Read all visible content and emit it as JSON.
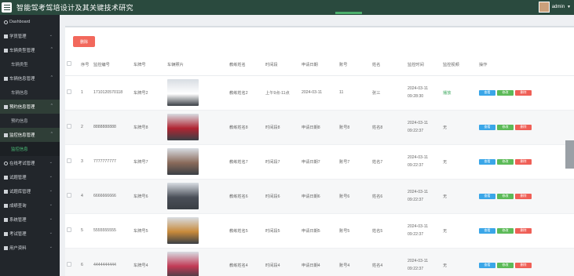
{
  "header": {
    "title": "智能驾考驾培设计及其关键技术研究",
    "user": "admin",
    "colors": {
      "bar": "#2a4a3e",
      "accent": "#4caf6c"
    }
  },
  "sidebar": {
    "items": [
      {
        "label": "Dashboard",
        "icon": "home-icon",
        "arrow": ""
      },
      {
        "label": "学员管理",
        "icon": "grid-icon",
        "arrow": "⌄"
      },
      {
        "label": "车辆类型管理",
        "icon": "grid-icon",
        "arrow": "^"
      },
      {
        "label": "车辆类型",
        "sub": true
      },
      {
        "label": "车辆信息管理",
        "icon": "grid-icon",
        "arrow": "^"
      },
      {
        "label": "车辆信息",
        "sub": true
      },
      {
        "label": "预约信息管理",
        "icon": "grid-icon",
        "arrow": "^",
        "active": true
      },
      {
        "label": "预约信息",
        "sub": true
      },
      {
        "label": "监控信息管理",
        "icon": "grid-icon",
        "arrow": "^",
        "active": true
      },
      {
        "label": "监控信息",
        "sub": true,
        "active": true
      },
      {
        "label": "在线考试管理",
        "icon": "gear-icon",
        "arrow": "⌄"
      },
      {
        "label": "试题管理",
        "icon": "grid-icon",
        "arrow": "⌄"
      },
      {
        "label": "试题库管理",
        "icon": "grid-icon",
        "arrow": "⌄"
      },
      {
        "label": "成绩查询",
        "icon": "grid-icon",
        "arrow": "⌄"
      },
      {
        "label": "系统管理",
        "icon": "grid-icon",
        "arrow": "⌄"
      },
      {
        "label": "考试管理",
        "icon": "grid-icon",
        "arrow": "⌄"
      },
      {
        "label": "用户资料",
        "icon": "doc-icon",
        "arrow": "⌄"
      }
    ]
  },
  "toolbar": {
    "delete_label": "删除"
  },
  "table": {
    "headers": [
      "序号",
      "监控编号",
      "车牌号",
      "车辆照片",
      "教练姓名",
      "时间段",
      "申请日期",
      "账号",
      "姓名",
      "监控时间",
      "监控视频",
      "操作"
    ],
    "actions": {
      "view": "查看",
      "edit": "修改",
      "delete": "删除"
    },
    "rows": [
      {
        "idx": "1",
        "code": "1710120570118",
        "plate": "车牌号2",
        "coach": "教练姓名2",
        "period": "上午9点-11点",
        "date": "2024-03-11",
        "account": "11",
        "name": "张三",
        "time": "2024-03-11 09:28:30",
        "video": "播放",
        "video_green": true,
        "photo": "#ffffff"
      },
      {
        "idx": "2",
        "code": "8888888888",
        "plate": "车牌号8",
        "coach": "教练姓名8",
        "period": "时间段8",
        "date": "申请日期8",
        "account": "账号8",
        "name": "姓名8",
        "time": "2024-03-11 09:22:37",
        "video": "无",
        "photo": "#b02532"
      },
      {
        "idx": "3",
        "code": "7777777777",
        "plate": "车牌号7",
        "coach": "教练姓名7",
        "period": "时间段7",
        "date": "申请日期7",
        "account": "账号7",
        "name": "姓名7",
        "time": "2024-03-11 09:22:37",
        "video": "无",
        "photo": "#8a6a5a"
      },
      {
        "idx": "4",
        "code": "6666666666",
        "plate": "车牌号6",
        "coach": "教练姓名6",
        "period": "时间段6",
        "date": "申请日期6",
        "account": "账号6",
        "name": "姓名6",
        "time": "2024-03-11 09:22:37",
        "video": "无",
        "photo": "#4a4f58"
      },
      {
        "idx": "5",
        "code": "5555555555",
        "plate": "车牌号5",
        "coach": "教练姓名5",
        "period": "时间段5",
        "date": "申请日期5",
        "account": "账号5",
        "name": "姓名5",
        "time": "2024-03-11 09:22:37",
        "video": "无",
        "photo": "#c88a3a"
      },
      {
        "idx": "6",
        "code": "4444444444",
        "plate": "车牌号4",
        "coach": "教练姓名4",
        "period": "时间段4",
        "date": "申请日期4",
        "account": "账号4",
        "name": "姓名4",
        "time": "2024-03-11 09:22:37",
        "video": "无",
        "photo": "#c23a55"
      }
    ]
  }
}
